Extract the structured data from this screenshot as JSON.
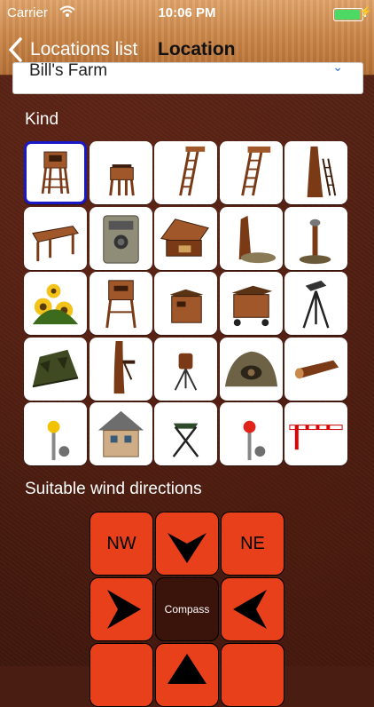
{
  "status": {
    "carrier": "Carrier",
    "time": "10:06 PM"
  },
  "nav": {
    "back_label": "Locations list",
    "title": "Location"
  },
  "name_field": {
    "value": "Bill's Farm"
  },
  "kind": {
    "label": "Kind",
    "selected_index": 0,
    "items": [
      "high-seat-enclosed",
      "low-seat",
      "ladder-stand",
      "ladder-stand-2",
      "tree-stand",
      "bench",
      "trail-camera",
      "feeding-hut",
      "salt-lick-stump",
      "lick-post",
      "sunflower-field",
      "covered-high-seat",
      "ground-hide-box",
      "mobile-hide-trailer",
      "tripod-stand",
      "camo-ground-blind",
      "tree-stand-platform",
      "barrel-feeder",
      "burrow",
      "log",
      "marker-yellow",
      "cabin",
      "folding-stool",
      "marker-red",
      "barrier-gate"
    ]
  },
  "wind": {
    "label": "Suitable wind directions",
    "buttons": {
      "nw": "NW",
      "ne": "NE",
      "center": "Compass"
    }
  },
  "colors": {
    "accent": "#1a19c8",
    "wind_active": "#e8401b",
    "leather": "#4a1d12"
  }
}
